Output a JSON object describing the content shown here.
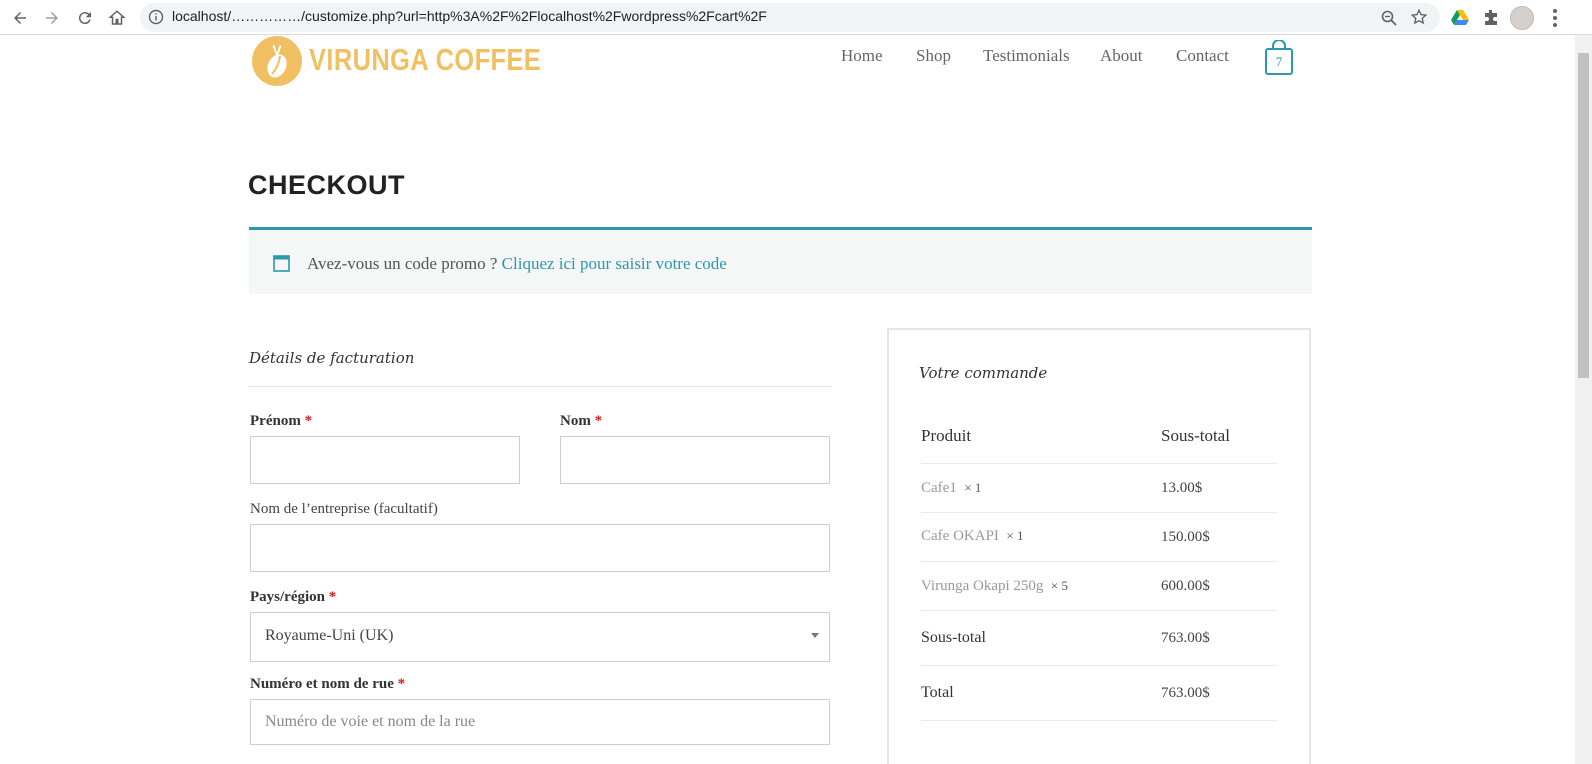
{
  "browser": {
    "url": "localhost/……………/customize.php?url=http%3A%2F%2Flocalhost%2Fwordpress%2Fcart%2F"
  },
  "header": {
    "logo_text": "VIRUNGA COFFEE",
    "logo_letter": "V",
    "menu": [
      "Home",
      "Shop",
      "Testimonials",
      "About",
      "Contact"
    ],
    "cart_count": "7"
  },
  "page": {
    "title": "CHECKOUT",
    "coupon_question": "Avez-vous un code promo ?",
    "coupon_link": "Cliquez ici pour saisir votre code"
  },
  "billing": {
    "title": "Détails de facturation",
    "first_name_label": "Prénom",
    "last_name_label": "Nom",
    "company_label": "Nom de l’entreprise (facultatif)",
    "country_label": "Pays/région",
    "country_value": "Royaume-Uni (UK)",
    "street_label": "Numéro et nom de rue",
    "street_placeholder": "Numéro de voie et nom de la rue",
    "required_mark": "*"
  },
  "order": {
    "title": "Votre commande",
    "col_product": "Produit",
    "col_subtotal": "Sous-total",
    "items": [
      {
        "name": "Cafe1",
        "qty": "× 1",
        "amount": "13.00$"
      },
      {
        "name": "Cafe OKAPI",
        "qty": "× 1",
        "amount": "150.00$"
      },
      {
        "name": "Virunga Okapi 250g",
        "qty": "× 5",
        "amount": "600.00$"
      }
    ],
    "subtotal_label": "Sous-total",
    "subtotal_value": "763.00$",
    "total_label": "Total",
    "total_value": "763.00$"
  },
  "colors": {
    "accent": "#2a98ad",
    "logo": "#f1c063",
    "required": "#d02020"
  }
}
